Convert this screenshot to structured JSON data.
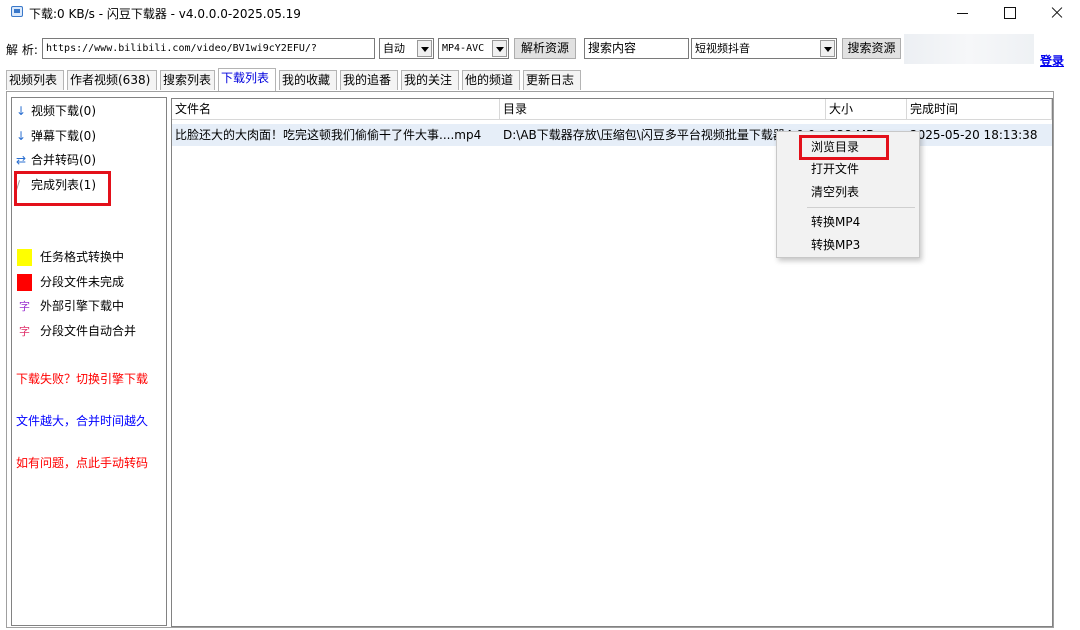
{
  "window": {
    "title": "下载:0 KB/s - 闪豆下载器 - v4.0.0.0-2025.05.19"
  },
  "toolbar": {
    "url_label": "解 析:",
    "url_value": "https://www.bilibili.com/video/BV1wi9cY2EFU/?",
    "quality_select": "自动",
    "format_select": "MP4-AVC",
    "parse_button": "解析资源",
    "search_value": "搜索内容",
    "platform_select": "短视频抖音",
    "search_button": "搜索资源",
    "login_link": "登录"
  },
  "tabs": [
    {
      "label": "视频列表"
    },
    {
      "label": "作者视频(638)"
    },
    {
      "label": "搜索列表"
    },
    {
      "label": "下载列表"
    },
    {
      "label": "我的收藏"
    },
    {
      "label": "我的追番"
    },
    {
      "label": "我的关注"
    },
    {
      "label": "他的频道"
    },
    {
      "label": "更新日志"
    }
  ],
  "active_tab": "下载列表",
  "sidebar": {
    "items": [
      {
        "icon": "↓",
        "label": "视频下载(0)"
      },
      {
        "icon": "↓",
        "label": "弹幕下载(0)"
      },
      {
        "icon": "⇄",
        "label": "合并转码(0)"
      },
      {
        "icon": "∕",
        "label": "完成列表(1)"
      }
    ],
    "legend": [
      {
        "label": "任务格式转换中",
        "color": "#ffff00"
      },
      {
        "label": "分段文件未完成",
        "color": "#ff0000"
      },
      {
        "label": "外部引擎下载中",
        "glyph": "字",
        "color": "#9b30d0"
      },
      {
        "label": "分段文件自动合并",
        "glyph": "字",
        "color": "#e0306a"
      }
    ],
    "notes": [
      {
        "text": "下载失败？切换引擎下载",
        "color": "#ff0000"
      },
      {
        "text": "文件越大，合并时间越久",
        "color": "#0000ff"
      },
      {
        "text": "如有问题，点此手动转码",
        "color": "#ff0000"
      }
    ]
  },
  "table": {
    "columns": [
      "文件名",
      "目录",
      "大小",
      "完成时间"
    ],
    "rows": [
      {
        "filename": "比脸还大的大肉面！吃完这顿我们偷偷干了件大事....mp4",
        "directory": "D:\\AB下载器存放\\压缩包\\闪豆多平台视频批量下载器4.0.0",
        "size": "338 MB",
        "completed": "2025-05-20 18:13:38"
      }
    ]
  },
  "context_menu": {
    "items": [
      "浏览目录",
      "打开文件",
      "清空列表",
      "转换MP4",
      "转换MP3"
    ]
  },
  "colors": {
    "highlight_box": "#e3101a",
    "active_tab_text": "#0000dd",
    "selected_row": "#e6eef8"
  }
}
